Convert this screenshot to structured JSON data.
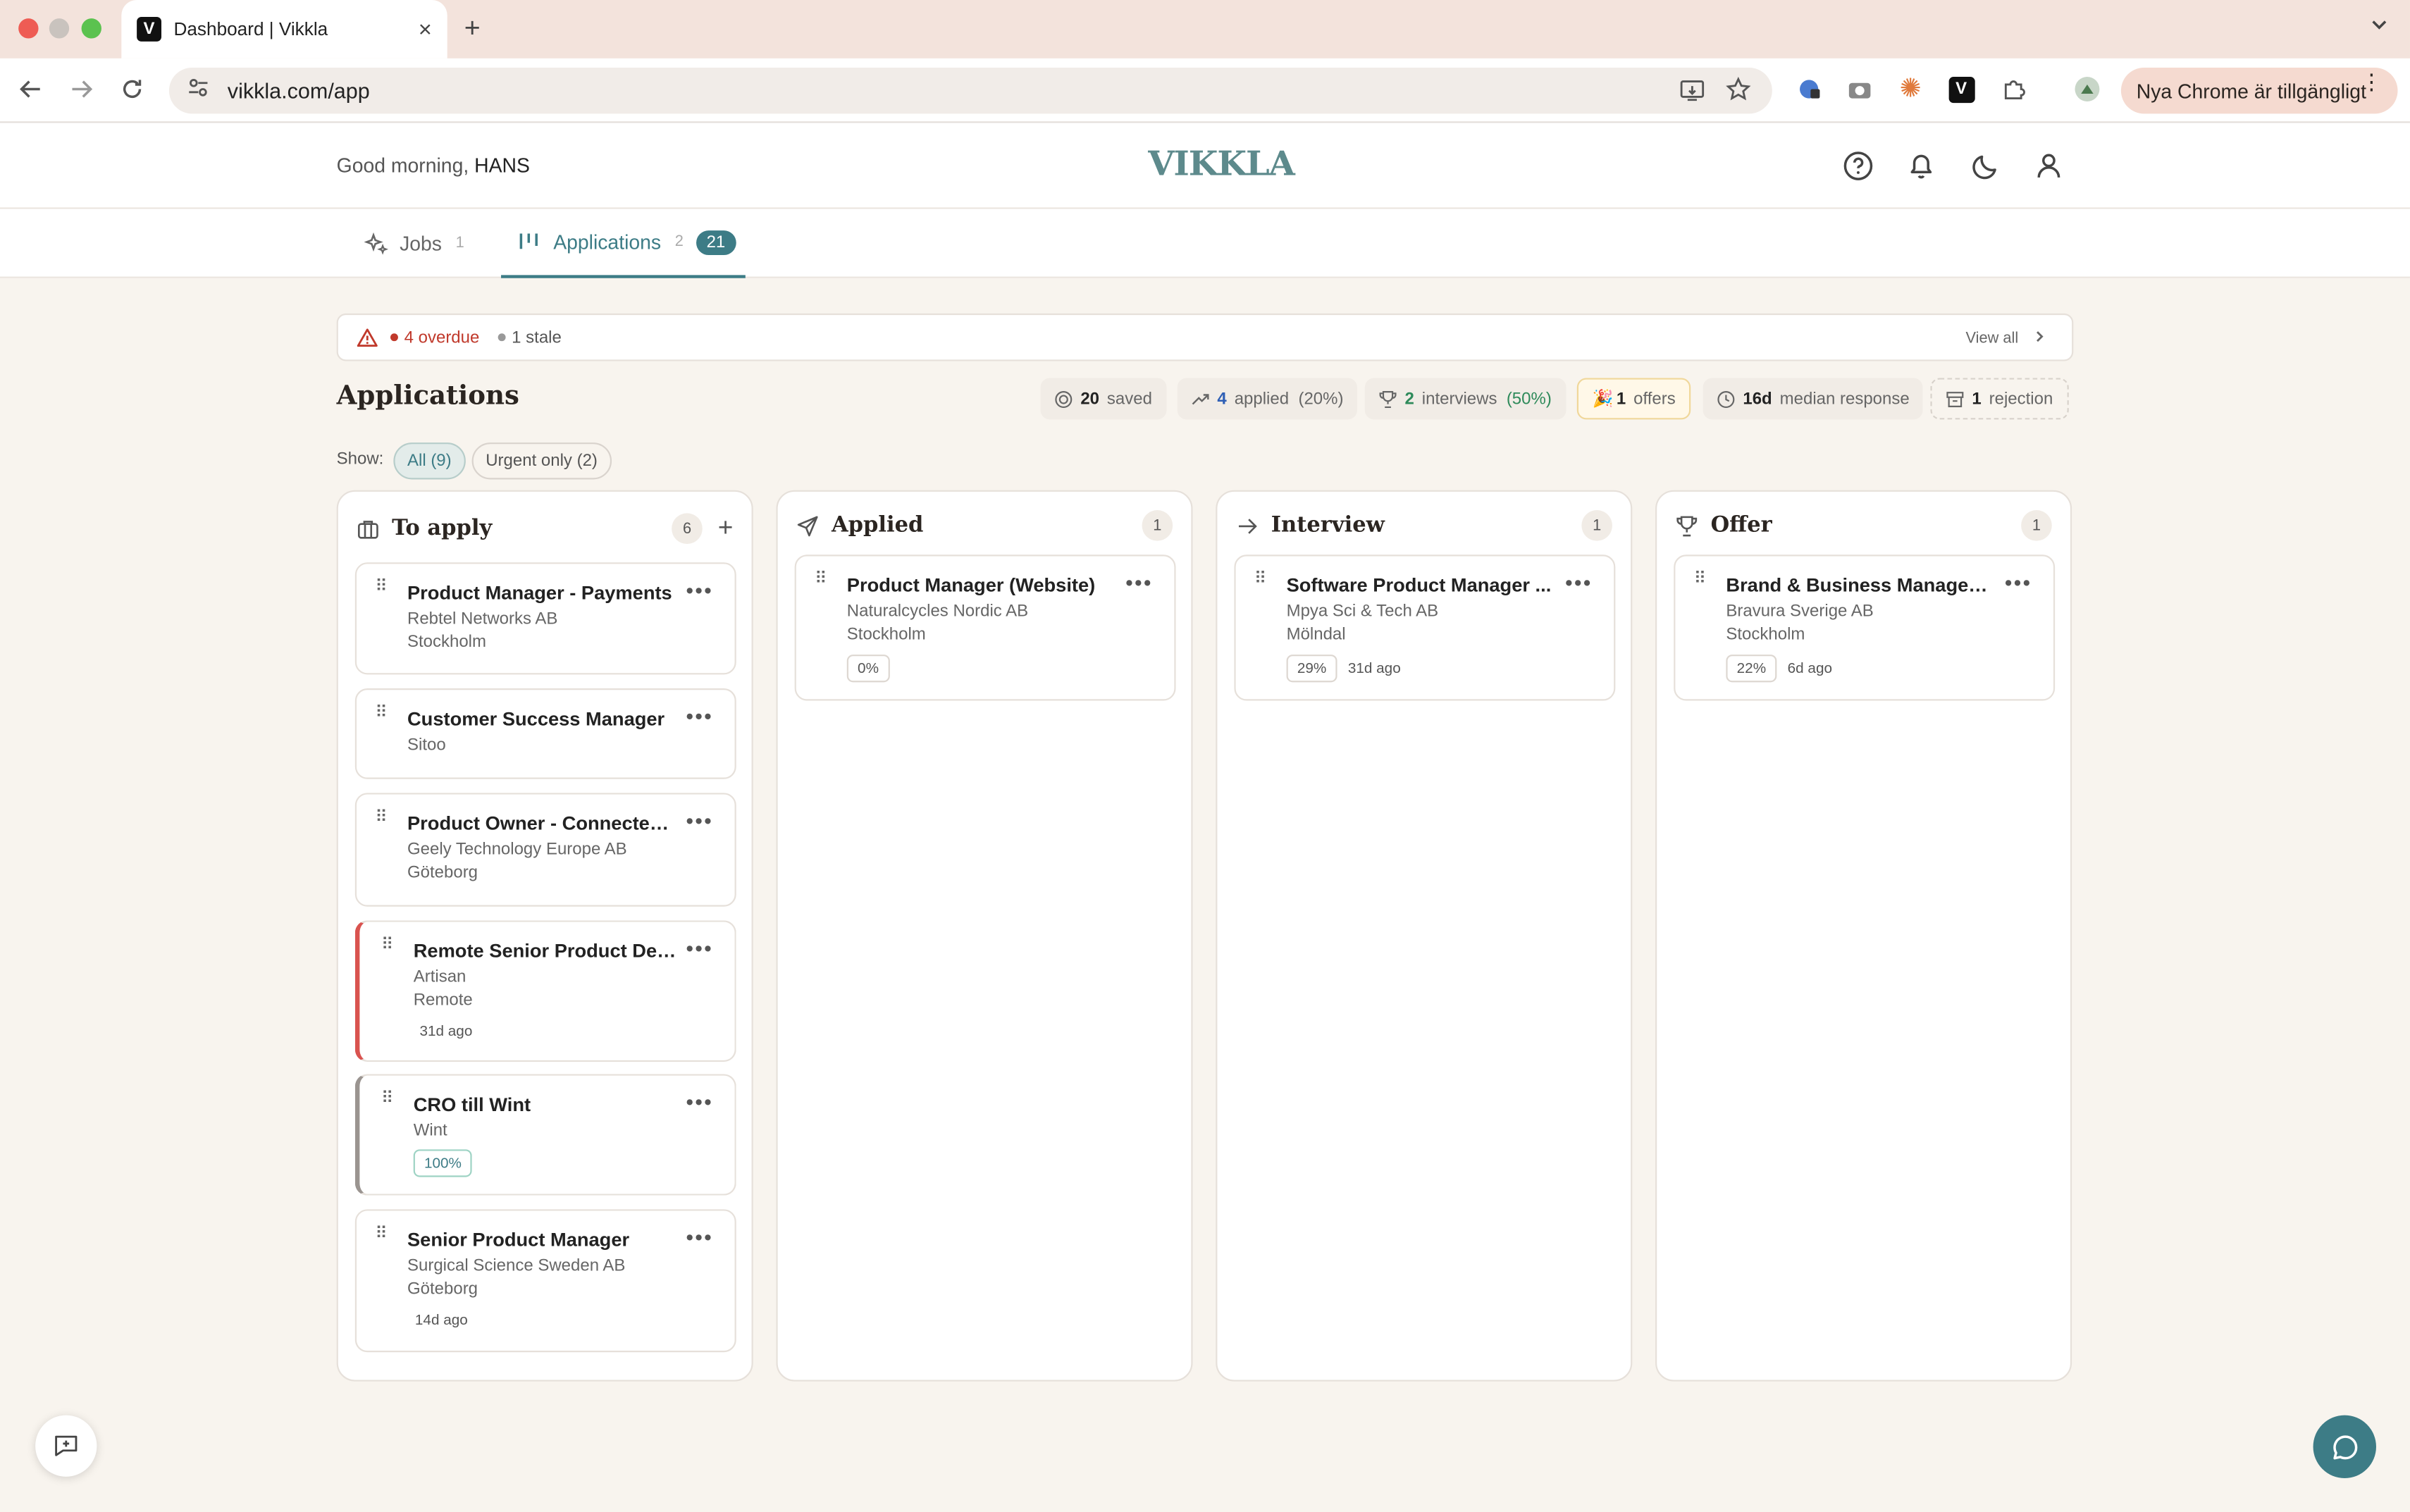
{
  "browser": {
    "tab_title": "Dashboard | Vikkla",
    "favicon_letter": "V",
    "url": "vikkla.com/app",
    "update_label": "Nya Chrome är tillgängligt"
  },
  "header": {
    "greeting": "Good morning,",
    "user": "HANS",
    "logo": "VIKKLA"
  },
  "nav": {
    "jobs_label": "Jobs",
    "jobs_count": "1",
    "apps_label": "Applications",
    "apps_count": "2",
    "apps_badge": "21"
  },
  "alert": {
    "overdue": "4 overdue",
    "stale": "1 stale",
    "view_all": "View all"
  },
  "title": "Applications",
  "stats": {
    "saved_num": "20",
    "saved_label": "saved",
    "applied_num": "4",
    "applied_label": "applied",
    "applied_pct": "(20%)",
    "interviews_num": "2",
    "interviews_label": "interviews",
    "interviews_pct": "(50%)",
    "offers_emoji": "🎉",
    "offers_num": "1",
    "offers_label": "offers",
    "median_num": "16d",
    "median_label": "median response",
    "rejection_num": "1",
    "rejection_label": "rejection"
  },
  "filters": {
    "show_label": "Show:",
    "all": "All (9)",
    "urgent": "Urgent only (2)"
  },
  "columns": {
    "to_apply": {
      "title": "To apply",
      "count": "6"
    },
    "applied": {
      "title": "Applied",
      "count": "1"
    },
    "interview": {
      "title": "Interview",
      "count": "1"
    },
    "offer": {
      "title": "Offer",
      "count": "1"
    }
  },
  "cards": {
    "c1": {
      "title": "Product Manager - Payments",
      "company": "Rebtel Networks AB",
      "location": "Stockholm"
    },
    "c2": {
      "title": "Customer Success Manager",
      "company": "Sitoo"
    },
    "c3": {
      "title": "Product Owner - Connected...",
      "company": "Geely Technology Europe AB",
      "location": "Göteborg"
    },
    "c4": {
      "title": "Remote Senior Product Des...",
      "company": "Artisan",
      "location": "Remote",
      "ago": "31d ago"
    },
    "c5": {
      "title": "CRO till Wint",
      "company": "Wint",
      "score": "100%"
    },
    "c6": {
      "title": "Senior Product Manager",
      "company": "Surgical Science Sweden AB",
      "location": "Göteborg",
      "ago": "14d ago"
    },
    "a1": {
      "title": "Product Manager (Website)",
      "company": "Naturalcycles Nordic AB",
      "location": "Stockholm",
      "score": "0%"
    },
    "i1": {
      "title": "Software Product Manager ...",
      "company": "Mpya Sci & Tech AB",
      "location": "Mölndal",
      "score": "29%",
      "ago": "31d ago"
    },
    "o1": {
      "title": "Brand & Business Manager t...",
      "company": "Bravura Sverige AB",
      "location": "Stockholm",
      "score": "22%",
      "ago": "6d ago"
    }
  },
  "colors": {
    "accent": "#3d7c86",
    "danger": "#c0392b",
    "background": "#f8f4ee"
  }
}
